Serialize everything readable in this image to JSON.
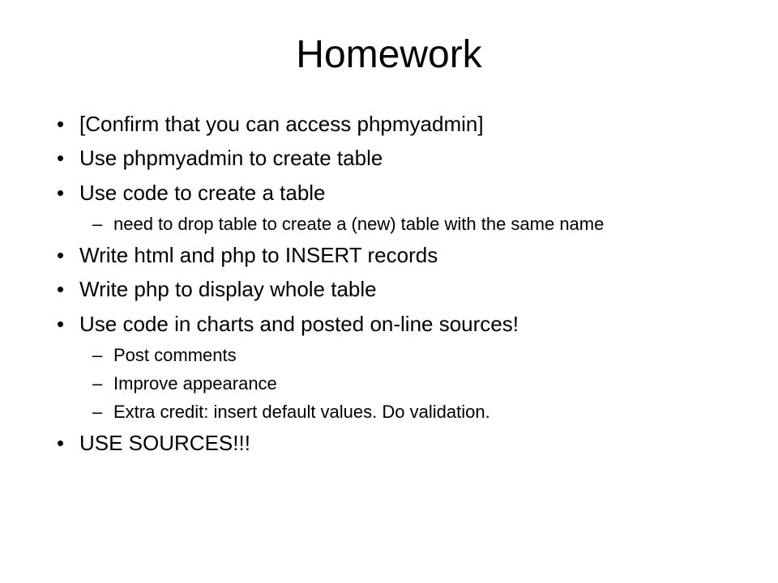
{
  "title": "Homework",
  "bullets": {
    "item1": "[Confirm that you can access phpmyadmin]",
    "item2": "Use phpmyadmin to create table",
    "item3": "Use code to create a table",
    "item3_sub1": "need to drop table to create a (new) table with the same name",
    "item4": "Write html and php to INSERT records",
    "item5": "Write php to display whole table",
    "item6": "Use code in charts and posted on-line sources!",
    "item6_sub1": "Post comments",
    "item6_sub2": "Improve appearance",
    "item6_sub3": "Extra credit: insert default values. Do validation.",
    "item7": "USE SOURCES!!!"
  }
}
